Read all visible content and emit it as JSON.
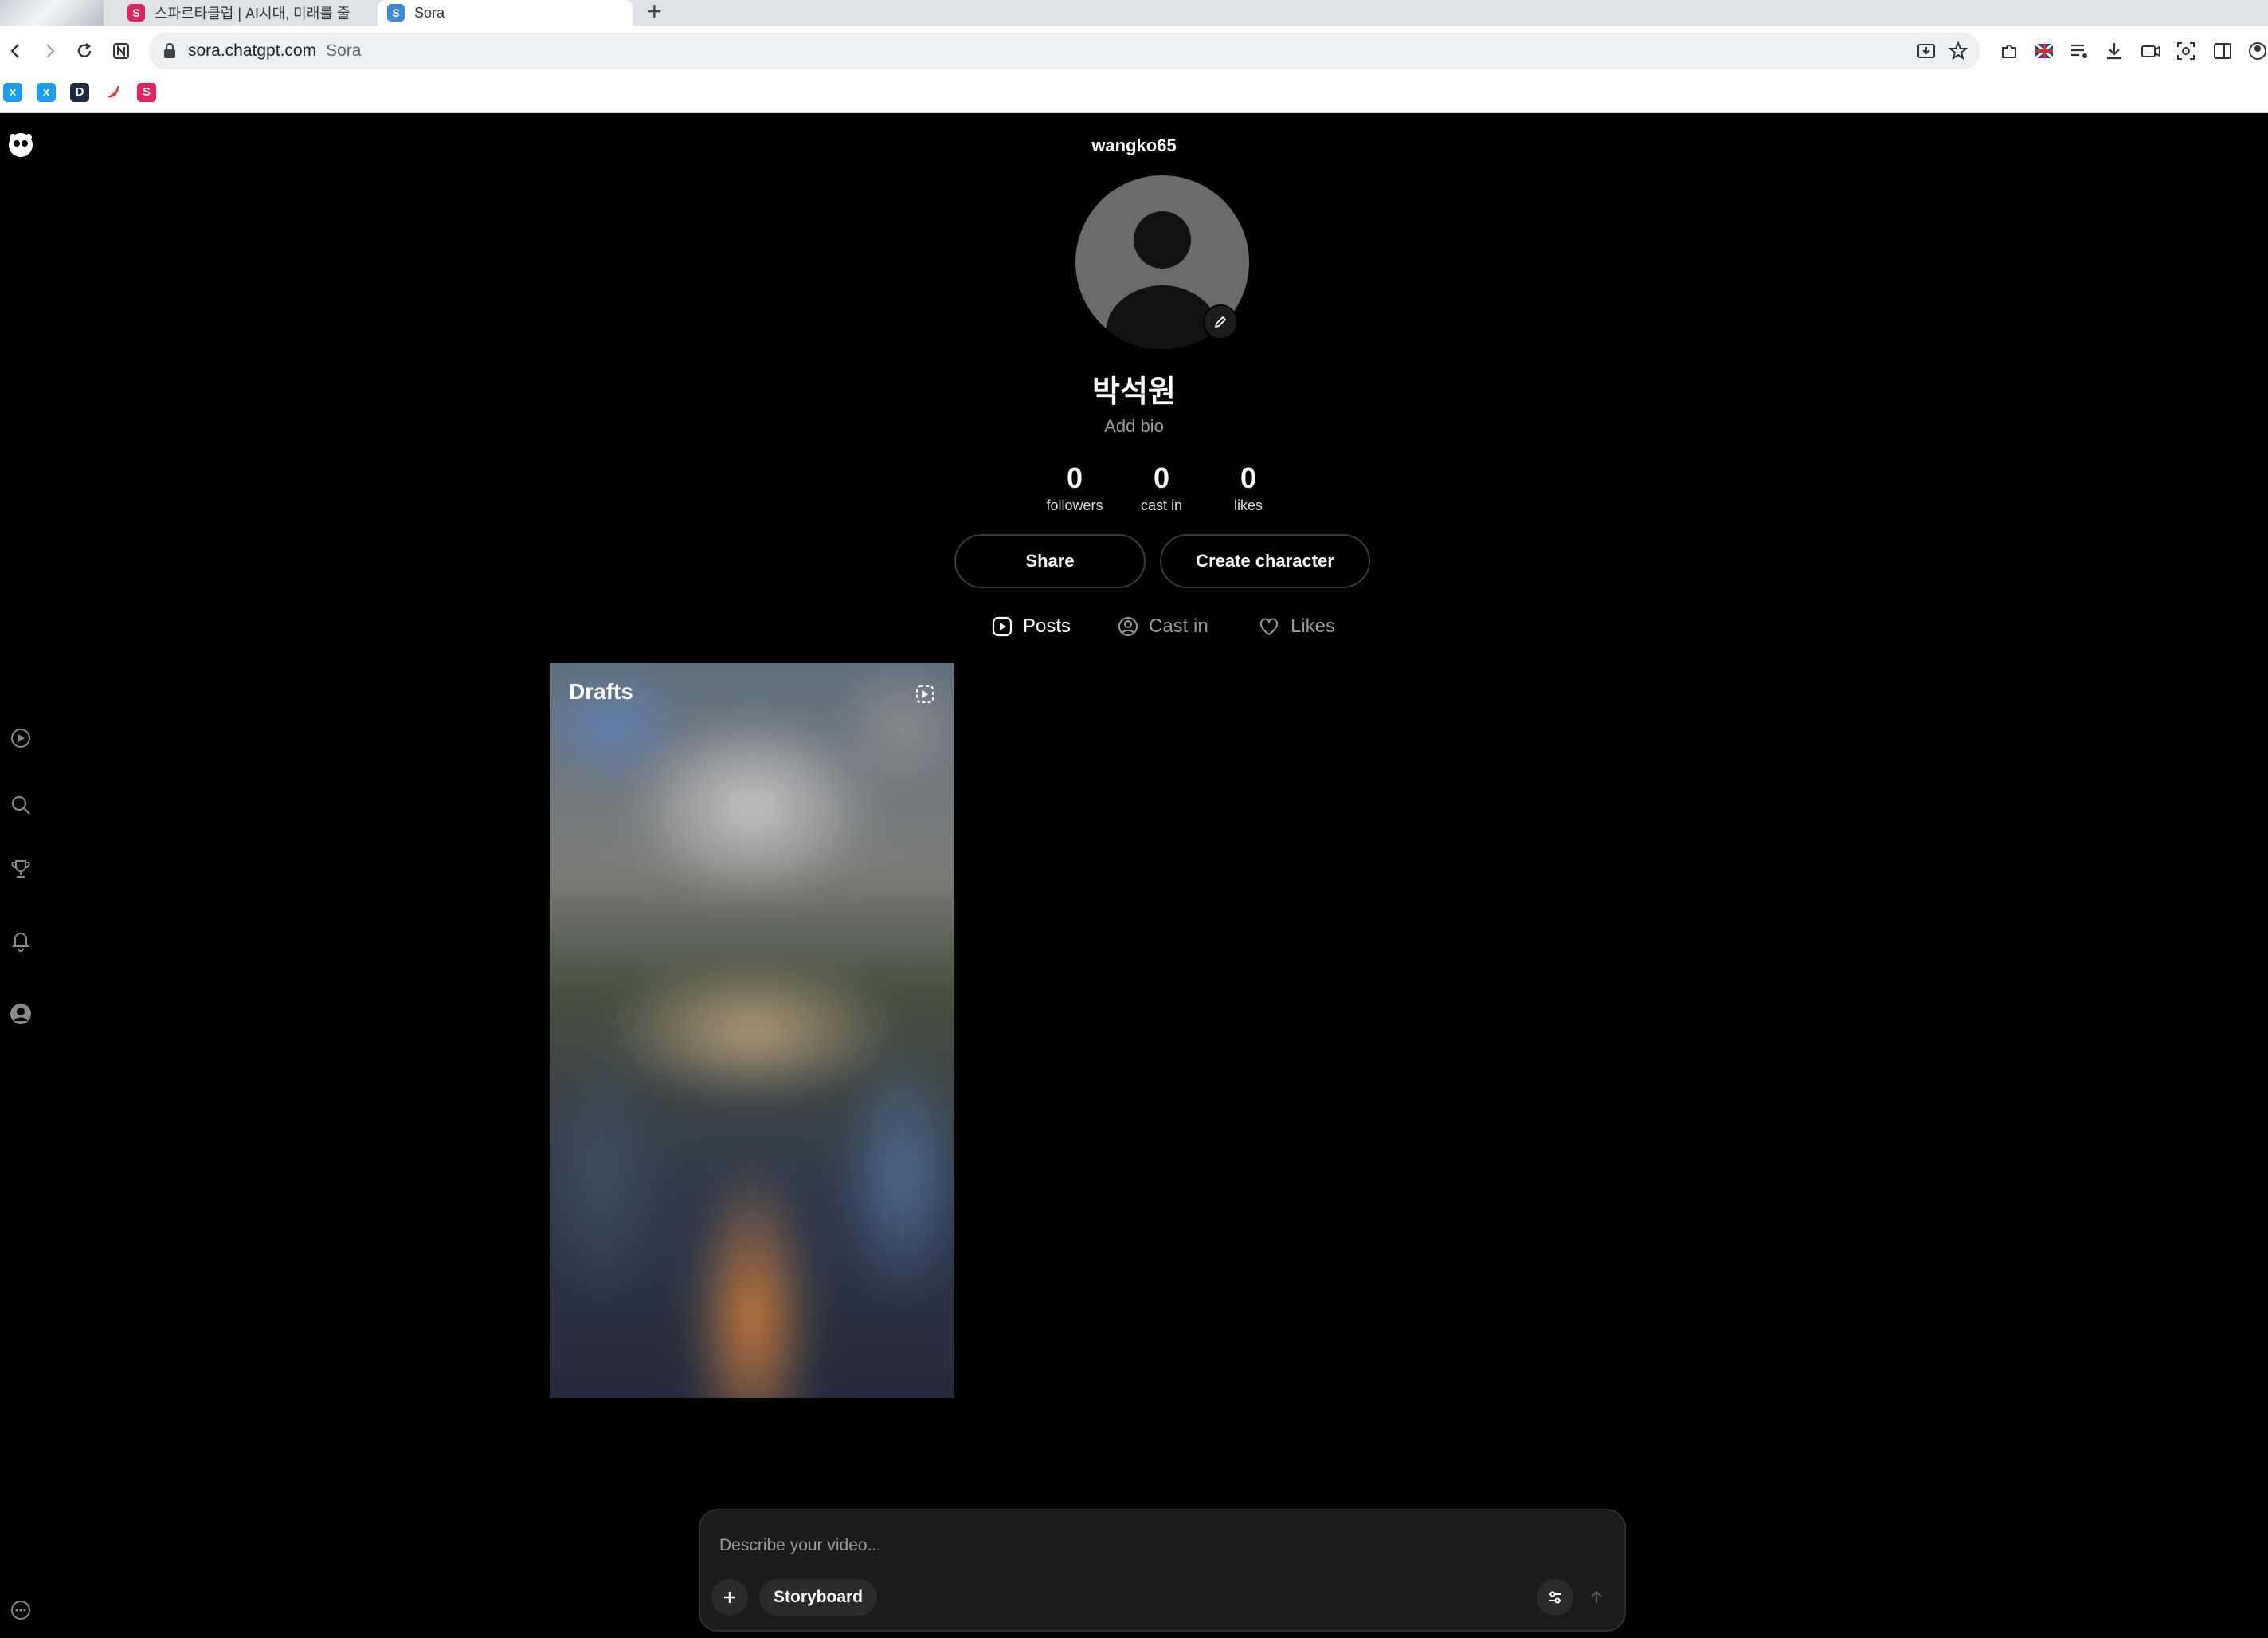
{
  "browser": {
    "tabs": [
      {
        "title": "스파르타클럽 | AI시대, 미래를 줄",
        "favicon": "S"
      },
      {
        "title": "Sora",
        "favicon": "S"
      }
    ],
    "new_tab": "+",
    "url": "sora.chatgpt.com",
    "site_name": "Sora",
    "bookmarks": [
      {
        "label": "x",
        "color": "#1d9bf0"
      },
      {
        "label": "x",
        "color": "#1d9bf0"
      },
      {
        "label": "D",
        "color": "#1f2a44"
      },
      {
        "label": "",
        "color": "#e53935"
      },
      {
        "label": "S",
        "color": "#e0245e"
      }
    ]
  },
  "profile": {
    "username": "wangko65",
    "display_name": "박석원",
    "bio_placeholder": "Add bio",
    "stats": [
      {
        "value": "0",
        "label": "followers"
      },
      {
        "value": "0",
        "label": "cast in"
      },
      {
        "value": "0",
        "label": "likes"
      }
    ],
    "share_label": "Share",
    "create_character_label": "Create character"
  },
  "profile_tabs": [
    {
      "label": "Posts",
      "icon": "play-square-icon",
      "active": true
    },
    {
      "label": "Cast in",
      "icon": "person-circle-icon",
      "active": false
    },
    {
      "label": "Likes",
      "icon": "heart-icon",
      "active": false
    }
  ],
  "drafts_card": {
    "title": "Drafts"
  },
  "composer": {
    "placeholder": "Describe your video...",
    "storyboard_label": "Storyboard"
  },
  "sidebar": [
    "sora-logo-icon",
    "feed-icon",
    "search-icon",
    "trophy-icon",
    "bell-icon",
    "profile-icon",
    "more-icon"
  ],
  "colors": {
    "background": "#000000",
    "accent": "#ffffff",
    "muted": "#9a9a9a"
  }
}
